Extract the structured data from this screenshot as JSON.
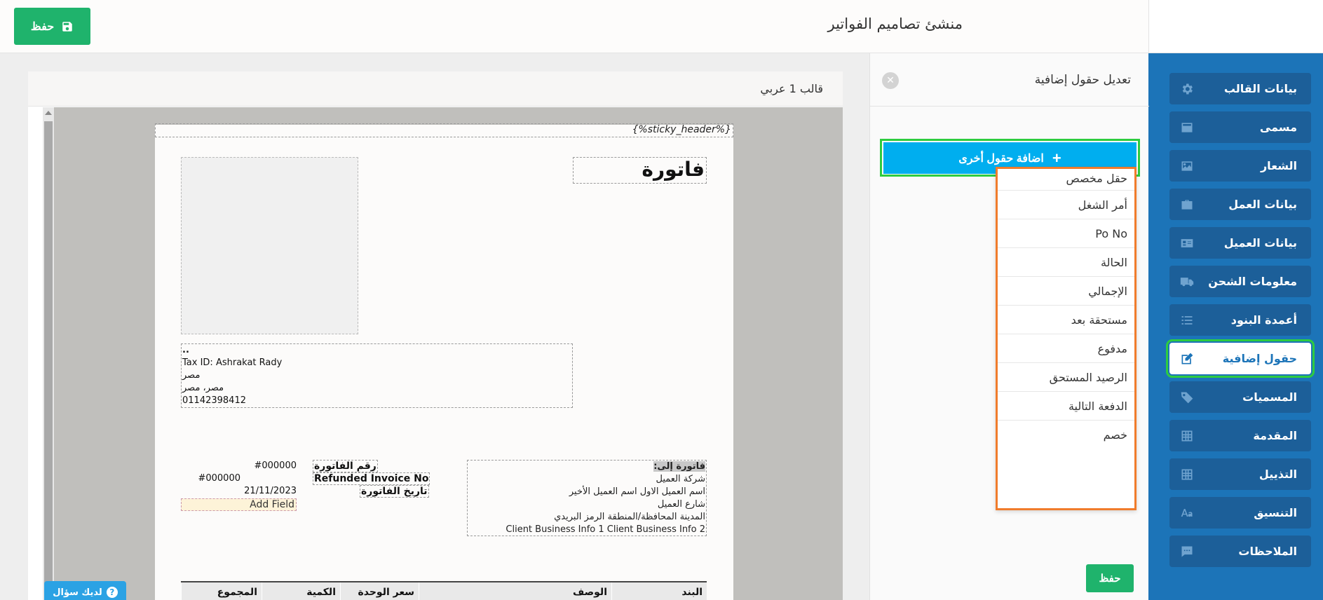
{
  "header": {
    "title": "منشئ تصاميم الفواتير",
    "save_label": "حفظ"
  },
  "sidebar": {
    "items": [
      {
        "label": "بيانات القالب",
        "icon": "gear-icon"
      },
      {
        "label": "مسمى",
        "icon": "card-icon"
      },
      {
        "label": "الشعار",
        "icon": "image-icon"
      },
      {
        "label": "بيانات العمل",
        "icon": "briefcase-icon"
      },
      {
        "label": "بيانات العميل",
        "icon": "id-card-icon"
      },
      {
        "label": "معلومات الشحن",
        "icon": "truck-icon"
      },
      {
        "label": "أعمدة البنود",
        "icon": "list-icon"
      },
      {
        "label": "حقول إضافية",
        "icon": "edit-icon"
      },
      {
        "label": "المسميات",
        "icon": "tag-icon"
      },
      {
        "label": "المقدمة",
        "icon": "grid-icon"
      },
      {
        "label": "التذييل",
        "icon": "grid-icon"
      },
      {
        "label": "التنسيق",
        "icon": "text-format-icon"
      },
      {
        "label": "الملاحظات",
        "icon": "comment-icon"
      }
    ],
    "active_index": 7
  },
  "panel": {
    "title": "تعديل حقول إضافية",
    "add_button_label": "اضافة حقول أخرى",
    "save_label": "حفظ",
    "dropdown_items": [
      "حقل مخصص",
      "أمر الشغل",
      "Po No",
      "الحالة",
      "الإجمالي",
      "مستحقة بعد",
      "مدفوع",
      "الرصيد المستحق",
      "الدفعة التالية",
      "خصم"
    ]
  },
  "preview": {
    "template_name": "قالب 1 عربي",
    "sticky_header": "{%sticky_header%}",
    "invoice_title": "فاتورة",
    "company": {
      "line1": "..",
      "line2": "Tax ID: Ashrakat Rady",
      "line3": "مصر",
      "line4": "مصر، مصر",
      "line5": "01142398412"
    },
    "bill_to": {
      "label": "فاتورة إلى:",
      "line1": "شركة العميل",
      "line2": "اسم العميل الاول اسم العميل الأخير",
      "line3": "شارع العميل",
      "line4": "المدينة المحافظة/المنطقة الرمز البريدي",
      "line5": "Client Business Info 1 Client Business Info 2"
    },
    "meta": {
      "invoice_no_label": "رقم الفاتورة",
      "invoice_no_value": "#000000",
      "refunded_label": "Refunded Invoice No",
      "refunded_value": "#000000",
      "date_label": "تاريخ الفاتورة",
      "date_value": "21/11/2023",
      "add_field": "Add Field"
    },
    "table_headers": [
      "البند",
      "الوصف",
      "سعر الوحدة",
      "الكمية",
      "المجموع"
    ]
  },
  "help": {
    "label": "لديك سؤال"
  },
  "colors": {
    "sidebar_bg": "#1c74b8",
    "sidebar_item": "#1c5f99",
    "primary_green": "#1fb36c",
    "add_button": "#00aeef",
    "highlight_green": "#2ecc40",
    "highlight_orange": "#f07c2c"
  }
}
